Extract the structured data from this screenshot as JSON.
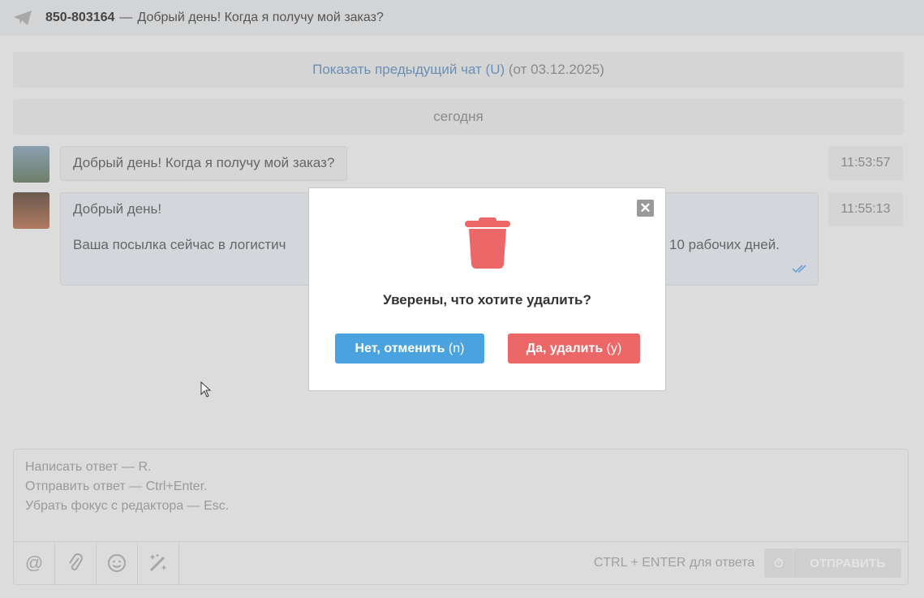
{
  "header": {
    "chat_id": "850-803164",
    "separator": "—",
    "last_message": "Добрый день! Когда я получу мой заказ?",
    "icon": "telegram-plane-icon"
  },
  "previous_chat": {
    "link": "Показать предыдущий чат (U)",
    "date": "(от 03.12.2025)"
  },
  "date_divider": "сегодня",
  "messages": [
    {
      "text": "Добрый день! Когда я получу мой заказ?",
      "time": "11:53:57"
    },
    {
      "line1": "Добрый день!",
      "line2_start": "Ваша посылка сейчас в логистич",
      "line2_end": "10 рабочих дней.",
      "time": "11:55:13",
      "status": "read"
    }
  ],
  "editor": {
    "placeholder_lines": [
      "Написать ответ — R.",
      "Отправить ответ — Ctrl+Enter.",
      "Убрать фокус с редактора — Esc."
    ],
    "hint": "CTRL + ENTER для ответа",
    "send_label": "ОТПРАВИТЬ"
  },
  "modal": {
    "question": "Уверены, что хотите удалить?",
    "cancel": "Нет, отменить",
    "cancel_key": "(n)",
    "confirm": "Да, удалить",
    "confirm_key": "(y)",
    "close": "✕"
  },
  "colors": {
    "cancel": "#4aa3df",
    "confirm": "#ec6767",
    "trash": "#ec6767"
  }
}
